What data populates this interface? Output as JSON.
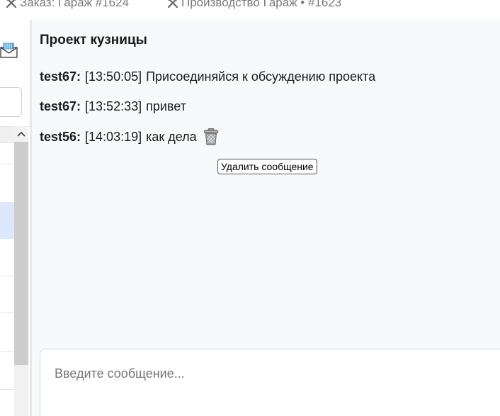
{
  "tabs": [
    {
      "label": "Заказ: Гараж #1624",
      "icon": "tools-icon"
    },
    {
      "label": "Производство Гараж • #1623",
      "icon": "tools-icon"
    }
  ],
  "chat": {
    "title": "Проект кузницы",
    "messages": [
      {
        "author": "test67:",
        "time": "[13:50:05]",
        "text": "Присоединяйся к обсуждению проекта"
      },
      {
        "author": "test67:",
        "time": "[13:52:33]",
        "text": "привет"
      },
      {
        "author": "test56:",
        "time": "[14:03:19]",
        "text": "как дела",
        "action_icon": "trash-icon"
      }
    ],
    "tooltip": "Удалить сообщение",
    "input_placeholder": "Введите сообщение..."
  },
  "icons": {
    "mail": "mail-icon",
    "scroll_up": "chevron-up-icon"
  },
  "colors": {
    "selected_row": "#dde8ff",
    "panel_background": "#f8f9fb"
  }
}
